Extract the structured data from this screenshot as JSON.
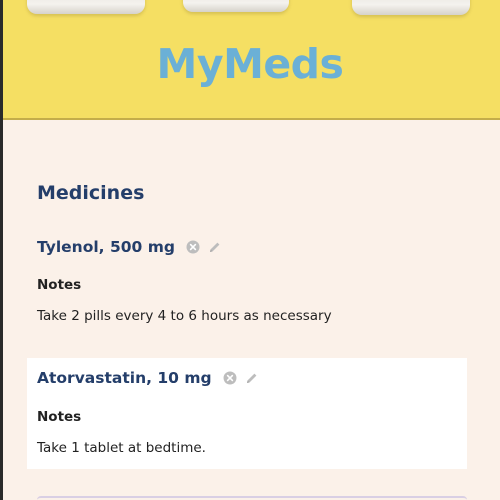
{
  "app": {
    "title": "MyMeds"
  },
  "page": {
    "section_title": "Medicines",
    "notes_label": "Notes"
  },
  "medicines": [
    {
      "name": "Tylenol, 500 mg",
      "notes": "Take 2 pills every 4 to 6 hours as necessary"
    },
    {
      "name": "Atorvastatin, 10 mg",
      "notes": "Take 1 tablet at bedtime."
    }
  ],
  "icons": {
    "delete": "circle-x-icon",
    "edit": "pencil-icon"
  },
  "colors": {
    "hero_background": "#f5df63",
    "brand_title": "#6bb0d6",
    "heading": "#243e6a",
    "page_background": "#fbf1e9",
    "card_highlight": "#ffffff",
    "icon_gray": "#b9b9b9"
  }
}
